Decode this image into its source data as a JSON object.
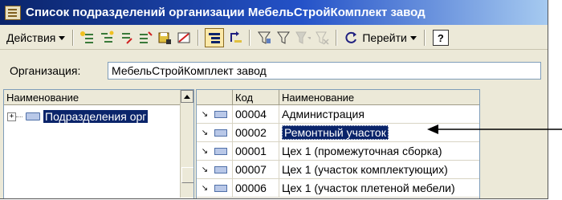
{
  "window": {
    "title": "Список подразделений организации МебельСтройКомплект завод"
  },
  "toolbar": {
    "actions_label": "Действия",
    "navigate_label": "Перейти",
    "help_label": "?"
  },
  "organization": {
    "label": "Организация:",
    "value": "МебельСтройКомплект завод"
  },
  "tree": {
    "header": "Наименование",
    "expander": "+",
    "root_label": "Подразделения орг"
  },
  "grid": {
    "columns": {
      "code": "Код",
      "name": "Наименование"
    },
    "rows": [
      {
        "code": "00004",
        "name": "Администрация"
      },
      {
        "code": "00002",
        "name": "Ремонтный участок"
      },
      {
        "code": "00001",
        "name": "Цех 1 (промежуточная сборка)"
      },
      {
        "code": "00007",
        "name": "Цех 1 (участок комплектующих)"
      },
      {
        "code": "00006",
        "name": "Цех 1 (участок плетеной мебели)"
      }
    ],
    "selected_row": 1
  }
}
